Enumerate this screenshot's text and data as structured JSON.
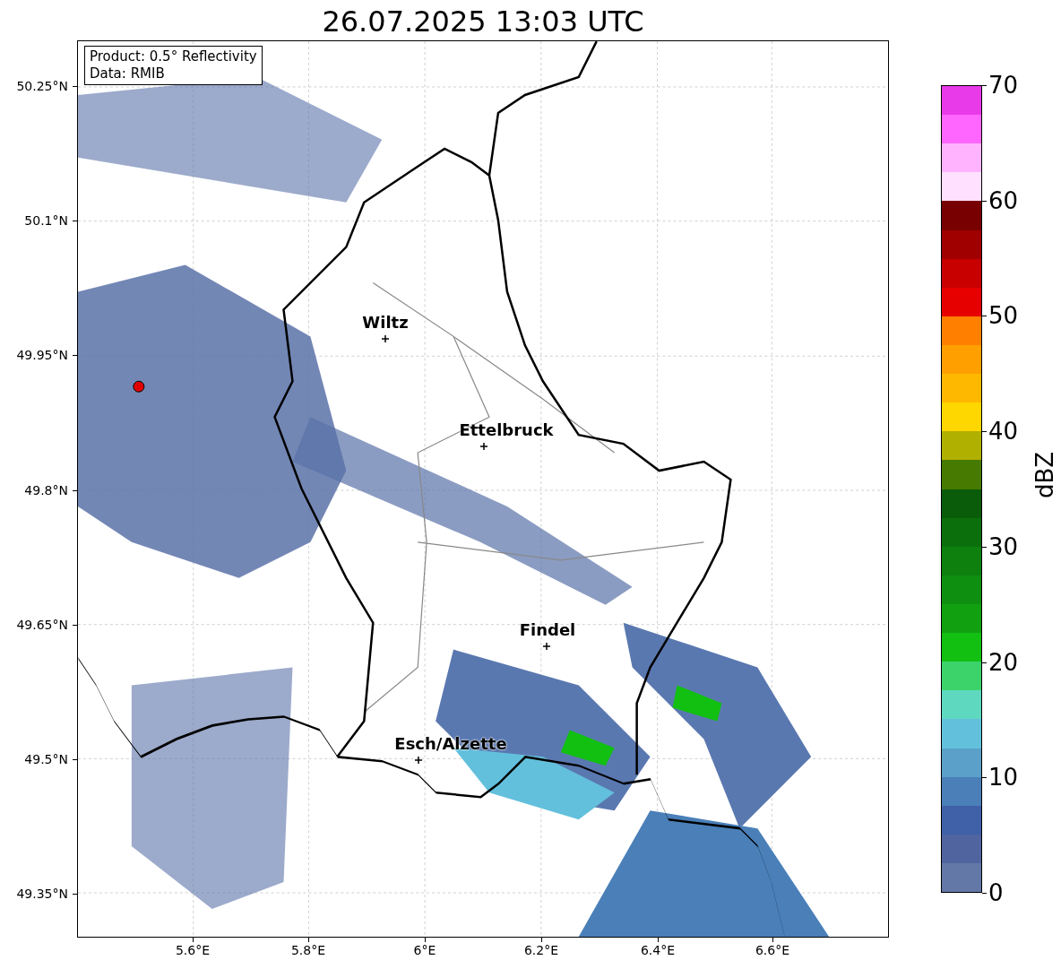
{
  "title": "26.07.2025 13:03 UTC",
  "info_box": [
    "Product: 0.5° Reflectivity",
    "Data: RMIB"
  ],
  "y_ticks": [
    "50.25°N",
    "50.1°N",
    "49.95°N",
    "49.8°N",
    "49.65°N",
    "49.5°N",
    "49.35°N"
  ],
  "x_ticks": [
    "5.6°E",
    "5.8°E",
    "6°E",
    "6.2°E",
    "6.4°E",
    "6.6°E"
  ],
  "cities": [
    {
      "name": "Wiltz"
    },
    {
      "name": "Ettelbruck"
    },
    {
      "name": "Findel"
    },
    {
      "name": "Esch/Alzette"
    }
  ],
  "colorbar": {
    "label": "dBZ",
    "ticks": [
      "70",
      "60",
      "50",
      "40",
      "30",
      "20",
      "10",
      "0"
    ],
    "segments": [
      {
        "color": "#e83ae8"
      },
      {
        "color": "#ff66ff"
      },
      {
        "color": "#ffb3ff"
      },
      {
        "color": "#ffe0ff"
      },
      {
        "color": "#780000"
      },
      {
        "color": "#a00000"
      },
      {
        "color": "#c80000"
      },
      {
        "color": "#e60000"
      },
      {
        "color": "#ff8000"
      },
      {
        "color": "#ff9f00"
      },
      {
        "color": "#ffb800"
      },
      {
        "color": "#ffd700"
      },
      {
        "color": "#b0b000"
      },
      {
        "color": "#467a00"
      },
      {
        "color": "#0a5c0a"
      },
      {
        "color": "#0b700b"
      },
      {
        "color": "#0d800d"
      },
      {
        "color": "#0f8f0f"
      },
      {
        "color": "#10a010"
      },
      {
        "color": "#12c012"
      },
      {
        "color": "#3dd36b"
      },
      {
        "color": "#5fd8c0"
      },
      {
        "color": "#63c0dc"
      },
      {
        "color": "#5aa0c8"
      },
      {
        "color": "#4a7fb8"
      },
      {
        "color": "#4060a8"
      },
      {
        "color": "#5064a0"
      },
      {
        "color": "#6478a8"
      }
    ]
  }
}
